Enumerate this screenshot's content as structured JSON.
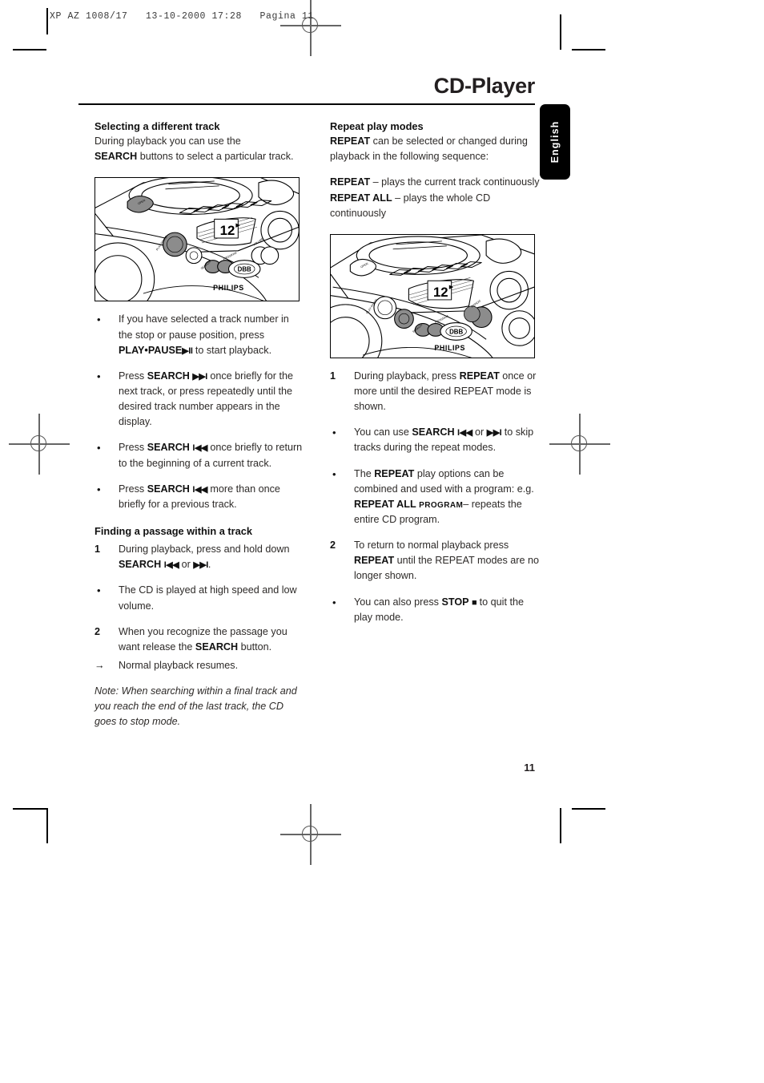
{
  "prepress": {
    "slug": "XP AZ 1008/17   13-10-2000 17:28   Pagina 11"
  },
  "header": {
    "title": "CD-Player",
    "language_tab": "English"
  },
  "footer": {
    "page_number": "11"
  },
  "left_column": {
    "section1": {
      "heading": "Selecting a different track",
      "intro_part1": "During playback you can use the",
      "intro_bold": "SEARCH",
      "intro_part2": "buttons to select a particular track."
    },
    "figure": {
      "caption_brand": "PHILIPS",
      "display_value": "12",
      "bass_label": "DBB",
      "alt": "Line drawing of Philips CD radio cassette recorder top panel with PLAY-PAUSE button highlighted"
    },
    "bullets": [
      {
        "marker": "•",
        "text_a": "If you have selected a track number in the stop or pause position, press",
        "bold": "PLAY•PAUSE",
        "glyph": "▶II",
        "text_b": "to start playback."
      },
      {
        "marker": "•",
        "text_a": "Press",
        "bold": "SEARCH",
        "glyph": "▶▶I",
        "text_b": "once briefly for the next track, or press repeatedly until the desired track number appears in the display."
      },
      {
        "marker": "•",
        "text_a": "Press",
        "bold": "SEARCH",
        "glyph": "I◀◀",
        "text_b": "once briefly to return to the beginning of a current track."
      },
      {
        "marker": "•",
        "text_a": "Press",
        "bold": "SEARCH",
        "glyph": "I◀◀",
        "text_b": "more than once briefly for a previous track."
      }
    ],
    "section2": {
      "heading": "Finding a passage within a track",
      "steps": [
        {
          "marker": "1",
          "text_a": "During playback, press and hold down",
          "bold": "SEARCH",
          "glyph_a": "I◀◀",
          "mid": "or",
          "glyph_b": "▶▶I",
          "text_b": "."
        },
        {
          "marker": "•",
          "text_a": "The CD is played at high speed and low volume."
        },
        {
          "marker": "2",
          "text_a": "When you recognize the passage you want release the",
          "bold": "SEARCH",
          "text_b": "button."
        },
        {
          "marker": "→",
          "text_a": "Normal playback resumes."
        }
      ],
      "note": "Note: When searching within a final track and you reach the end of the last track, the CD goes to stop mode."
    }
  },
  "right_column": {
    "section1": {
      "heading": "Repeat play modes",
      "lead_bold": "REPEAT",
      "lead_text": "can be selected or changed during playback in the following sequence:",
      "mode1_bold": "REPEAT",
      "mode1_text": "– plays the current track continuously",
      "mode2_bold": "REPEAT ALL",
      "mode2_text": "– plays the whole CD continuously"
    },
    "figure": {
      "caption_brand": "PHILIPS",
      "display_value": "12",
      "bass_label": "DBB",
      "alt": "Line drawing of Philips CD radio cassette recorder top panel with STOP and REPEAT buttons highlighted"
    },
    "steps": [
      {
        "marker": "1",
        "text_a": "During playback, press",
        "bold": "REPEAT",
        "text_b": "once or more until the desired REPEAT mode is shown."
      },
      {
        "marker": "•",
        "text_a": "You can use",
        "bold": "SEARCH",
        "glyph_a": "I◀◀",
        "mid": "or",
        "glyph_b": "▶▶I",
        "text_b": "to skip tracks during the repeat modes."
      },
      {
        "marker": "•",
        "text_a": "The",
        "bold": "REPEAT",
        "text_b": "play options can be combined and used with a program: e.g.",
        "bold2": "REPEAT ALL",
        "smallcaps": "PROGRAM",
        "text_c": "– repeats the entire CD program."
      },
      {
        "marker": "2",
        "text_a": "To return to normal playback press",
        "bold": "REPEAT",
        "text_b": "until the REPEAT modes are no longer shown."
      },
      {
        "marker": "•",
        "text_a": "You can also press",
        "bold": "STOP",
        "glyph": "■",
        "text_b": "to quit the play mode."
      }
    ]
  }
}
